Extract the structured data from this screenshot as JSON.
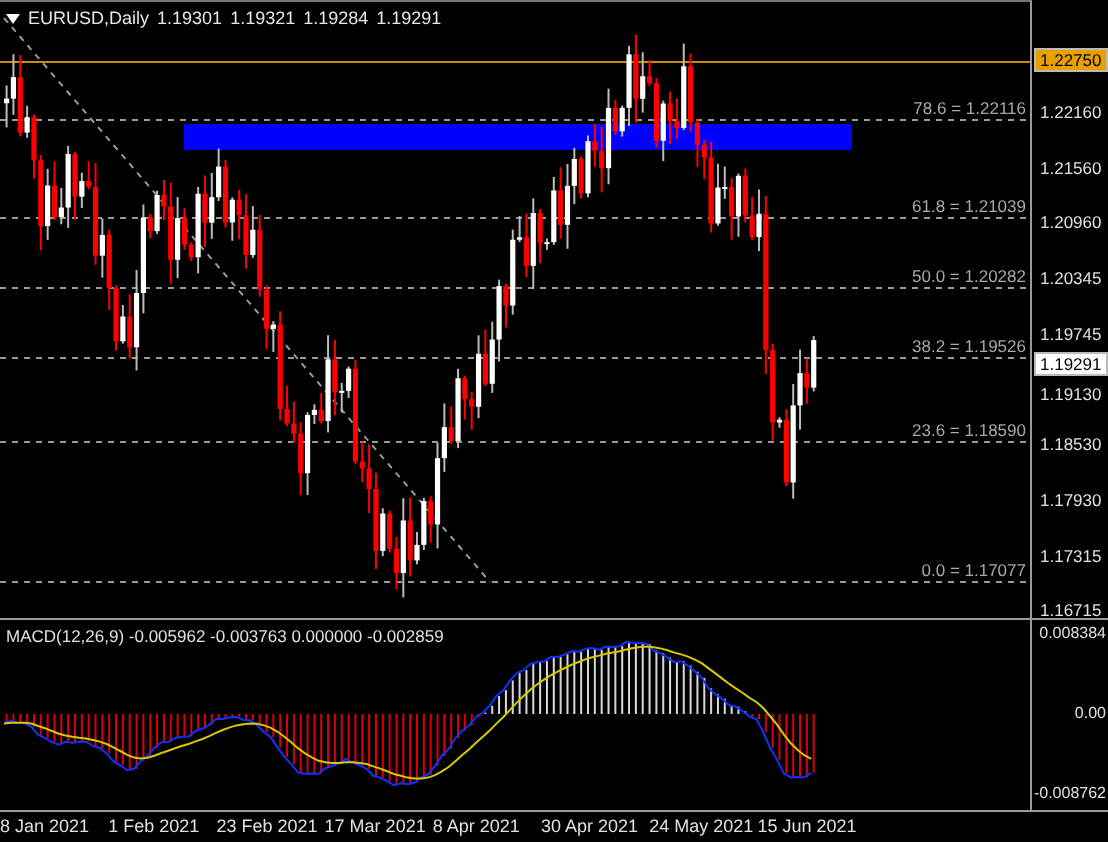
{
  "chart": {
    "symbol": "EURUSD,Daily",
    "ohlc": [
      "1.19301",
      "1.19321",
      "1.19284",
      "1.19291"
    ],
    "fib_levels": [
      {
        "label": "78.6 = 1.22116"
      },
      {
        "label": "61.8 = 1.21039"
      },
      {
        "label": "50.0 = 1.20282"
      },
      {
        "label": "38.2 = 1.19526"
      },
      {
        "label": "23.6 = 1.18590"
      },
      {
        "label": "0.0 = 1.17077"
      }
    ],
    "price_axis": [
      "1.22160",
      "1.21560",
      "1.20960",
      "1.20345",
      "1.19745",
      "1.19130",
      "1.18530",
      "1.17930",
      "1.17315",
      "1.16715"
    ],
    "high_line_label": "1.22750",
    "bid_label": "1.19291"
  },
  "macd": {
    "label": "MACD(12,26,9) -0.005962 -0.003763 0.000000 -0.002859",
    "axis": [
      "0.008384",
      "0.00",
      "-0.008762"
    ]
  },
  "time_axis": [
    "8 Jan 2021",
    "1 Feb 2021",
    "23 Feb 2021",
    "17 Mar 2021",
    "8 Apr 2021",
    "30 Apr 2021",
    "24 May 2021",
    "15 Jun 2021"
  ]
}
